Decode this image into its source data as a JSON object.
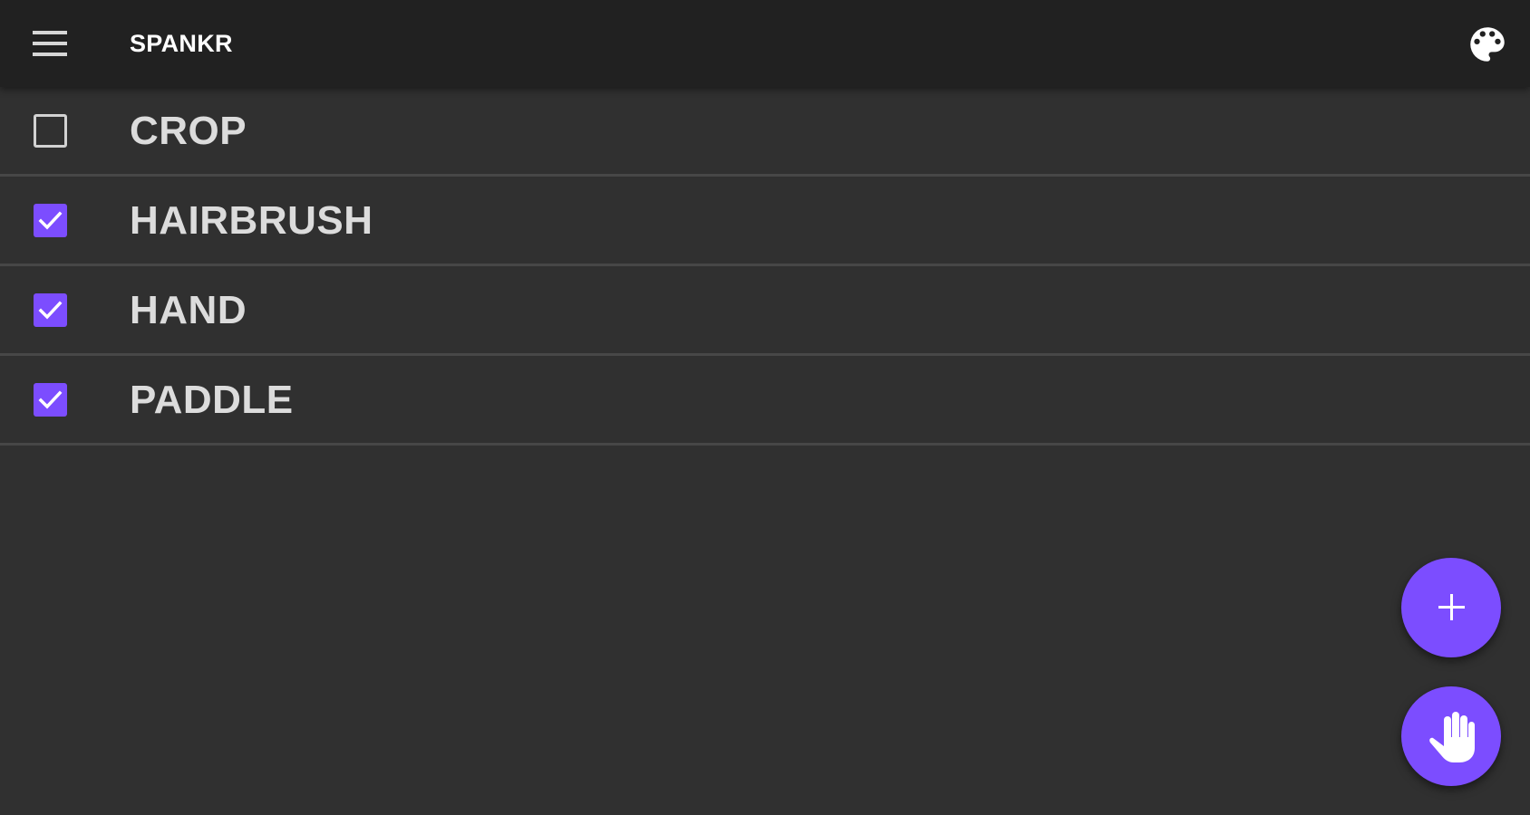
{
  "app": {
    "title": "SPANKR",
    "background_color": "#303030",
    "toolbar_color": "#212121",
    "accent_color": "#7c4dff"
  },
  "toolbar": {
    "menu_icon": "menu-icon",
    "palette_icon": "palette-icon"
  },
  "implements": [
    {
      "label": "CROP",
      "checked": false
    },
    {
      "label": "HAIRBRUSH",
      "checked": true
    },
    {
      "label": "HAND",
      "checked": true
    },
    {
      "label": "PADDLE",
      "checked": true
    }
  ],
  "fabs": {
    "add_icon": "plus-icon",
    "spank_icon": "hand-icon"
  }
}
